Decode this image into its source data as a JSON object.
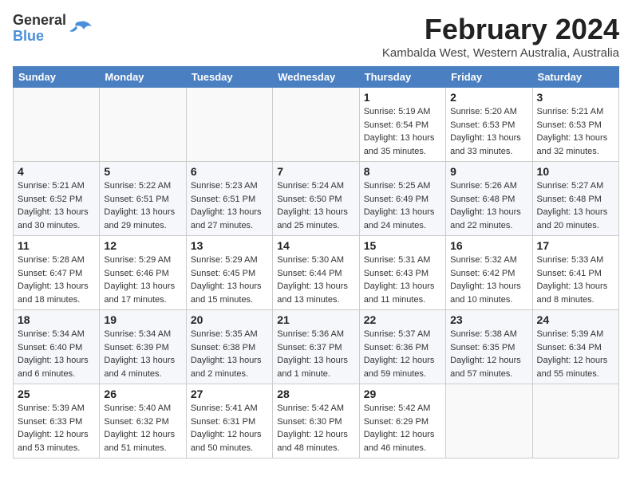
{
  "logo": {
    "general": "General",
    "blue": "Blue"
  },
  "title": "February 2024",
  "subtitle": "Kambalda West, Western Australia, Australia",
  "days_of_week": [
    "Sunday",
    "Monday",
    "Tuesday",
    "Wednesday",
    "Thursday",
    "Friday",
    "Saturday"
  ],
  "weeks": [
    [
      {
        "day": "",
        "info": ""
      },
      {
        "day": "",
        "info": ""
      },
      {
        "day": "",
        "info": ""
      },
      {
        "day": "",
        "info": ""
      },
      {
        "day": "1",
        "info": "Sunrise: 5:19 AM\nSunset: 6:54 PM\nDaylight: 13 hours\nand 35 minutes."
      },
      {
        "day": "2",
        "info": "Sunrise: 5:20 AM\nSunset: 6:53 PM\nDaylight: 13 hours\nand 33 minutes."
      },
      {
        "day": "3",
        "info": "Sunrise: 5:21 AM\nSunset: 6:53 PM\nDaylight: 13 hours\nand 32 minutes."
      }
    ],
    [
      {
        "day": "4",
        "info": "Sunrise: 5:21 AM\nSunset: 6:52 PM\nDaylight: 13 hours\nand 30 minutes."
      },
      {
        "day": "5",
        "info": "Sunrise: 5:22 AM\nSunset: 6:51 PM\nDaylight: 13 hours\nand 29 minutes."
      },
      {
        "day": "6",
        "info": "Sunrise: 5:23 AM\nSunset: 6:51 PM\nDaylight: 13 hours\nand 27 minutes."
      },
      {
        "day": "7",
        "info": "Sunrise: 5:24 AM\nSunset: 6:50 PM\nDaylight: 13 hours\nand 25 minutes."
      },
      {
        "day": "8",
        "info": "Sunrise: 5:25 AM\nSunset: 6:49 PM\nDaylight: 13 hours\nand 24 minutes."
      },
      {
        "day": "9",
        "info": "Sunrise: 5:26 AM\nSunset: 6:48 PM\nDaylight: 13 hours\nand 22 minutes."
      },
      {
        "day": "10",
        "info": "Sunrise: 5:27 AM\nSunset: 6:48 PM\nDaylight: 13 hours\nand 20 minutes."
      }
    ],
    [
      {
        "day": "11",
        "info": "Sunrise: 5:28 AM\nSunset: 6:47 PM\nDaylight: 13 hours\nand 18 minutes."
      },
      {
        "day": "12",
        "info": "Sunrise: 5:29 AM\nSunset: 6:46 PM\nDaylight: 13 hours\nand 17 minutes."
      },
      {
        "day": "13",
        "info": "Sunrise: 5:29 AM\nSunset: 6:45 PM\nDaylight: 13 hours\nand 15 minutes."
      },
      {
        "day": "14",
        "info": "Sunrise: 5:30 AM\nSunset: 6:44 PM\nDaylight: 13 hours\nand 13 minutes."
      },
      {
        "day": "15",
        "info": "Sunrise: 5:31 AM\nSunset: 6:43 PM\nDaylight: 13 hours\nand 11 minutes."
      },
      {
        "day": "16",
        "info": "Sunrise: 5:32 AM\nSunset: 6:42 PM\nDaylight: 13 hours\nand 10 minutes."
      },
      {
        "day": "17",
        "info": "Sunrise: 5:33 AM\nSunset: 6:41 PM\nDaylight: 13 hours\nand 8 minutes."
      }
    ],
    [
      {
        "day": "18",
        "info": "Sunrise: 5:34 AM\nSunset: 6:40 PM\nDaylight: 13 hours\nand 6 minutes."
      },
      {
        "day": "19",
        "info": "Sunrise: 5:34 AM\nSunset: 6:39 PM\nDaylight: 13 hours\nand 4 minutes."
      },
      {
        "day": "20",
        "info": "Sunrise: 5:35 AM\nSunset: 6:38 PM\nDaylight: 13 hours\nand 2 minutes."
      },
      {
        "day": "21",
        "info": "Sunrise: 5:36 AM\nSunset: 6:37 PM\nDaylight: 13 hours\nand 1 minute."
      },
      {
        "day": "22",
        "info": "Sunrise: 5:37 AM\nSunset: 6:36 PM\nDaylight: 12 hours\nand 59 minutes."
      },
      {
        "day": "23",
        "info": "Sunrise: 5:38 AM\nSunset: 6:35 PM\nDaylight: 12 hours\nand 57 minutes."
      },
      {
        "day": "24",
        "info": "Sunrise: 5:39 AM\nSunset: 6:34 PM\nDaylight: 12 hours\nand 55 minutes."
      }
    ],
    [
      {
        "day": "25",
        "info": "Sunrise: 5:39 AM\nSunset: 6:33 PM\nDaylight: 12 hours\nand 53 minutes."
      },
      {
        "day": "26",
        "info": "Sunrise: 5:40 AM\nSunset: 6:32 PM\nDaylight: 12 hours\nand 51 minutes."
      },
      {
        "day": "27",
        "info": "Sunrise: 5:41 AM\nSunset: 6:31 PM\nDaylight: 12 hours\nand 50 minutes."
      },
      {
        "day": "28",
        "info": "Sunrise: 5:42 AM\nSunset: 6:30 PM\nDaylight: 12 hours\nand 48 minutes."
      },
      {
        "day": "29",
        "info": "Sunrise: 5:42 AM\nSunset: 6:29 PM\nDaylight: 12 hours\nand 46 minutes."
      },
      {
        "day": "",
        "info": ""
      },
      {
        "day": "",
        "info": ""
      }
    ]
  ]
}
